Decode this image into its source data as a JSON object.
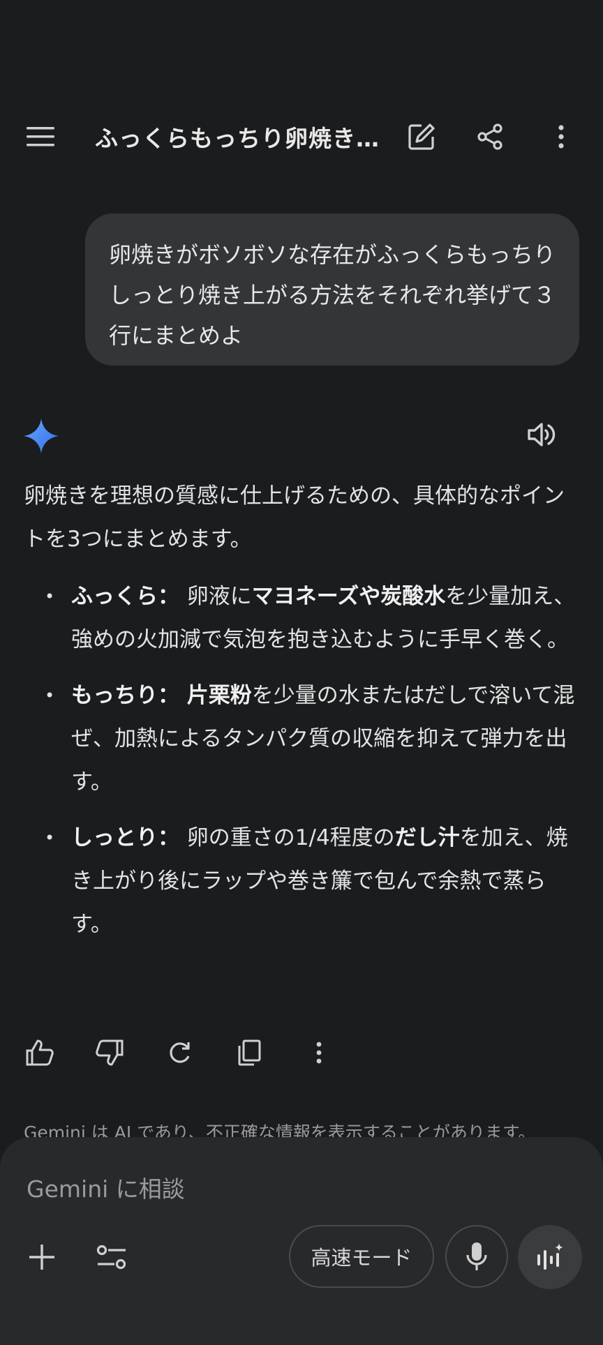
{
  "header": {
    "title": "ふっくらもっちり卵焼き…"
  },
  "user_message": "卵焼きがボソボソな存在がふっくらもっちりしっとり焼き上がる方法をそれぞれ挙げて３行にまとめよ",
  "response": {
    "intro": "卵焼きを理想の質感に仕上げるための、具体的なポイントを3つにまとめます。",
    "bullets": [
      {
        "label": "ふっくら：",
        "segments": [
          {
            "text": "卵液に",
            "bold": false
          },
          {
            "text": "マヨネーズや炭酸水",
            "bold": true
          },
          {
            "text": "を少量加え、強めの火加減で気泡を抱き込むように手早く巻く。",
            "bold": false
          }
        ]
      },
      {
        "label": "もっちり：",
        "segments": [
          {
            "text": "片栗粉",
            "bold": true
          },
          {
            "text": "を少量の水またはだしで溶いて混ぜ、加熱によるタンパク質の収縮を抑えて弾力を出す。",
            "bold": false
          }
        ]
      },
      {
        "label": "しっとり：",
        "segments": [
          {
            "text": "卵の重さの1/4程度の",
            "bold": false
          },
          {
            "text": "だし汁",
            "bold": true
          },
          {
            "text": "を加え、焼き上がり後にラップや巻き簾で包んで余熱で蒸らす。",
            "bold": false
          }
        ]
      }
    ]
  },
  "disclaimer": "Gemini は AI であり、不正確な情報を表示することがあります。",
  "composer": {
    "placeholder": "Gemini に相談",
    "mode_label": "高速モード"
  },
  "colors": {
    "background": "#1b1c1e",
    "bubble": "#333537",
    "composer": "#28292b",
    "gemini_blue": "#4a8af4"
  }
}
